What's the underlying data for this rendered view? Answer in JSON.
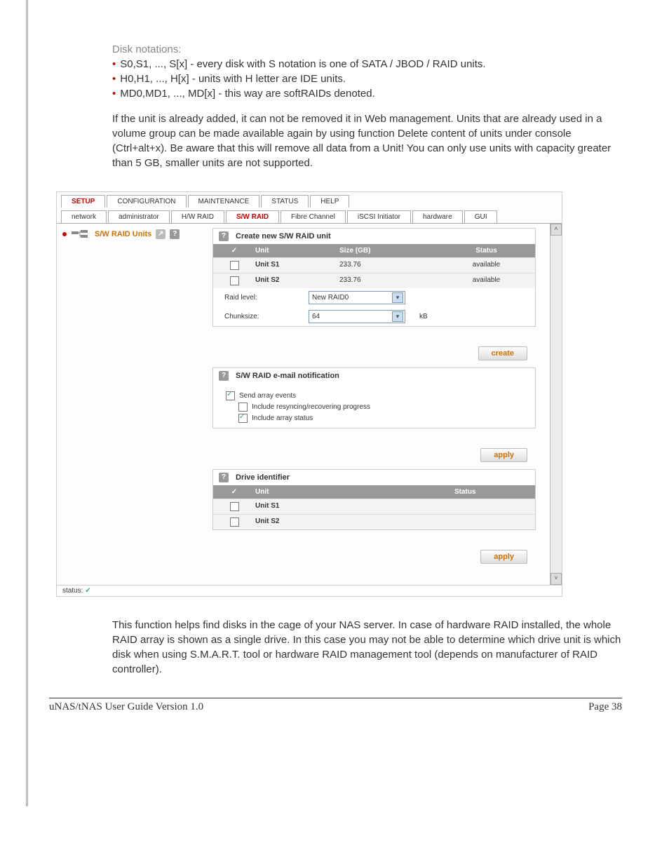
{
  "text": {
    "disk_notations": "Disk notations:",
    "b1": "S0,S1, ..., S[x] - every disk with S notation is one of SATA / JBOD / RAID units.",
    "b2": "H0,H1, ..., H[x] - units with H letter are IDE units.",
    "b3": "MD0,MD1, ..., MD[x] - this way are softRAIDs denoted.",
    "para1": "If the unit is already added, it can not be removed it in Web management. Units that are already used in a volume group can be made available again by using function Delete content of units under console (Ctrl+alt+x). Be aware that this will remove all data from a Unit! You can only use units with capacity greater than 5 GB, smaller units are not supported.",
    "para2": "This function helps find disks in the cage of your NAS server. In case of hardware RAID installed, the whole RAID array is shown as a single drive. In this case you may not be able to determine which drive unit is which disk when using S.M.A.R.T. tool or hardware RAID management tool (depends on manufacturer of RAID controller)."
  },
  "main_tabs": [
    "SETUP",
    "CONFIGURATION",
    "MAINTENANCE",
    "STATUS",
    "HELP"
  ],
  "main_tab_active": "SETUP",
  "sub_tabs": [
    "network",
    "administrator",
    "H/W RAID",
    "S/W RAID",
    "Fibre Channel",
    "iSCSI Initiator",
    "hardware",
    "GUI"
  ],
  "sub_tab_active": "S/W RAID",
  "sidebar_title": "S/W RAID Units",
  "panel1": {
    "title": "Create new S/W RAID unit",
    "headers": {
      "unit": "Unit",
      "size": "Size (GB)",
      "status": "Status"
    },
    "rows": [
      {
        "unit": "Unit S1",
        "size": "233.76",
        "status": "available"
      },
      {
        "unit": "Unit S2",
        "size": "233.76",
        "status": "available"
      }
    ],
    "raid_label": "Raid level:",
    "raid_value": "New RAID0",
    "chunk_label": "Chunksize:",
    "chunk_value": "64",
    "chunk_unit": "kB",
    "button": "create"
  },
  "panel2": {
    "title": "S/W RAID e-mail notification",
    "opt1": "Send array events",
    "opt2": "Include resyncing/recovering progress",
    "opt3": "Include array status",
    "button": "apply"
  },
  "panel3": {
    "title": "Drive identifier",
    "headers": {
      "unit": "Unit",
      "status": "Status"
    },
    "rows": [
      {
        "unit": "Unit S1"
      },
      {
        "unit": "Unit S2"
      }
    ],
    "button": "apply"
  },
  "status_label": "status:",
  "footer": {
    "left": "uNAS/tNAS User Guide Version 1.0",
    "right": "Page 38"
  }
}
